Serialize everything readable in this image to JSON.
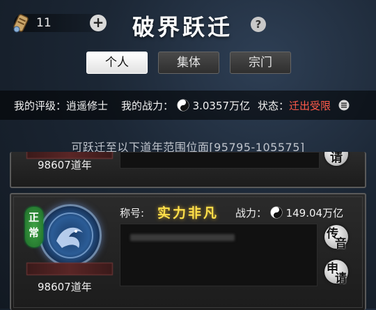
{
  "header": {
    "token_count": "11",
    "title": "破界跃迁",
    "help_glyph": "?",
    "plus_glyph": "+"
  },
  "tabs": [
    {
      "label": "个人",
      "active": true
    },
    {
      "label": "集体",
      "active": false
    },
    {
      "label": "宗门",
      "active": false
    }
  ],
  "info": {
    "rating_label": "我的评级：",
    "rating_value": "逍遥修士",
    "power_label": "我的战力：",
    "power_value": "3.0357万亿",
    "status_label": "状态：",
    "status_value": "迁出受限"
  },
  "range_text": "可跃迁至以下道年范围位面[95795-105575]",
  "cards": [
    {
      "realm": "98607道年",
      "buttons": [
        "请"
      ]
    },
    {
      "badge": [
        "正",
        "常"
      ],
      "title_label": "称号:",
      "title_value": "实力非凡",
      "power_label": "战力：",
      "power_value": "149.04万亿",
      "realm": "98607道年",
      "buttons": [
        "传音",
        "申请"
      ]
    }
  ],
  "colors": {
    "status_red": "#ff5a4a",
    "title_gold": "#ffe14a",
    "badge_green": "#2f8a36"
  },
  "icons": [
    "scroll-token-icon",
    "plus-icon",
    "help-icon",
    "yin-yang-icon",
    "list-icon"
  ]
}
